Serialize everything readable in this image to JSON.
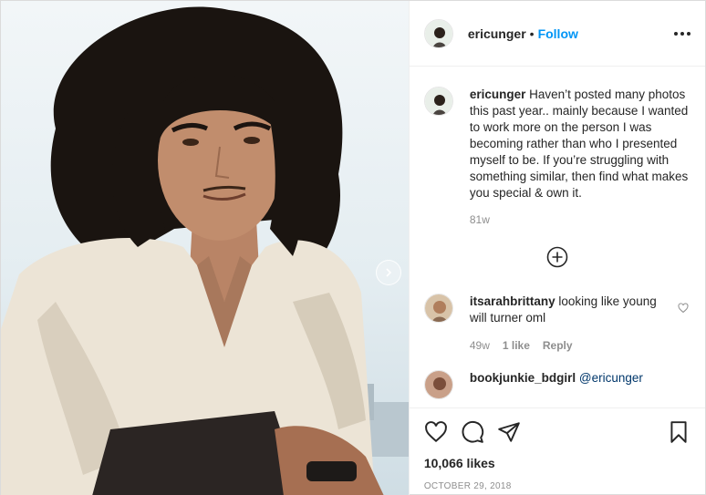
{
  "post": {
    "author": "ericunger",
    "separator": "•",
    "follow_label": "Follow",
    "caption_author": "ericunger",
    "caption_text": "Haven’t posted many photos this past year.. mainly because I wanted to work more on the person I was becoming rather than who I presented myself to be. If you’re struggling with something similar, then find what makes you special & own it.",
    "caption_time": "81w",
    "likes": "10,066 likes",
    "date": "OCTOBER 29, 2018"
  },
  "comments": [
    {
      "author": "itsarahbrittany",
      "text": "looking like young will turner oml",
      "time": "49w",
      "likes": "1 like",
      "reply": "Reply"
    },
    {
      "author": "bookjunkie_bdgirl",
      "mention": "@ericunger",
      "text": ""
    }
  ],
  "icons": {
    "more": "more-options-icon",
    "next": "chevron-right-icon",
    "load_more": "plus-circle-icon",
    "like": "heart-icon",
    "comment": "comment-bubble-icon",
    "share": "paper-plane-icon",
    "save": "bookmark-icon"
  },
  "colors": {
    "follow": "#0095f6",
    "text": "#262626",
    "muted": "#8e8e8e",
    "border": "#dbdbdb"
  }
}
